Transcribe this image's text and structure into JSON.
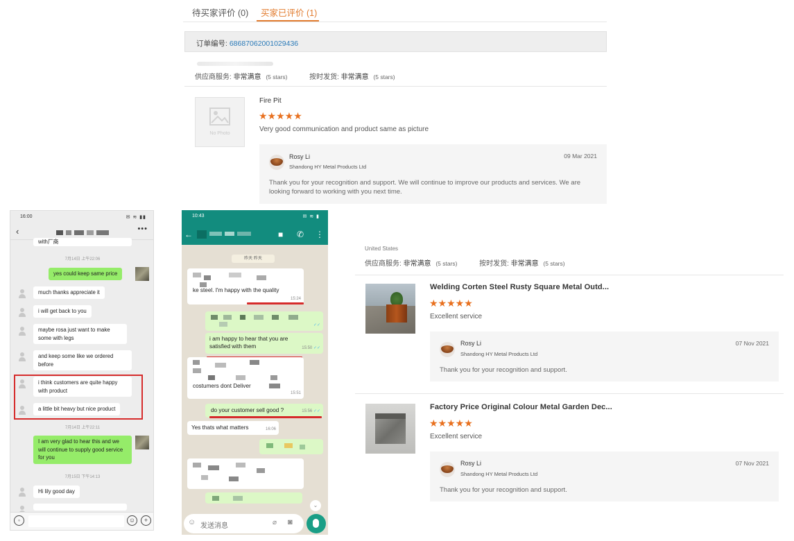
{
  "top_panel": {
    "tabs": [
      {
        "label": "待买家评价 (0)",
        "active": false
      },
      {
        "label": "买家已评价 (1)",
        "active": true
      }
    ],
    "order_label": "订单编号:",
    "order_number": "68687062001029436",
    "ratings": {
      "service_label": "供应商服务:",
      "service_value": "非常满意",
      "service_stars": "(5 stars)",
      "delivery_label": "按时发货:",
      "delivery_value": "非常满意",
      "delivery_stars": "(5 stars)"
    },
    "review": {
      "product": "Fire Pit",
      "no_photo_text": "No Photo",
      "stars": "★★★★★",
      "text": "Very good communication and product same as picture",
      "reply": {
        "name": "Rosy Li",
        "company": "Shandong HY Metal Products Ltd",
        "date": "09 Mar 2021",
        "text": "Thank you for your recognition and support. We will continue to improve our products and services. We are looking forward to working with you next time."
      }
    }
  },
  "chat_left": {
    "status_time": "16:00",
    "status_icons": "✉ ≋ ▮▮",
    "more": "•••",
    "messages": [
      {
        "text": "with厂商",
        "side": "in"
      },
      {
        "timestamp": "7月14日 上午22:06"
      },
      {
        "text": "yes could keep same price",
        "side": "out"
      },
      {
        "text": "much thanks appreciate it",
        "side": "in"
      },
      {
        "text": "i will get back to you",
        "side": "in"
      },
      {
        "text": "maybe rosa just want to make some with legs",
        "side": "in"
      },
      {
        "text": "and keep some like we ordered before",
        "side": "in"
      },
      {
        "text": "i think customers are quite happy with product",
        "side": "in"
      },
      {
        "text": "a little bit heavy but nice product",
        "side": "in"
      },
      {
        "timestamp": "7月14日 上午22:11"
      },
      {
        "text": "I am very glad to hear this and we will continue to supply good service for you",
        "side": "out"
      },
      {
        "timestamp": "7月15日 下午14:13"
      },
      {
        "text": "Hi lily good day",
        "side": "in"
      }
    ]
  },
  "chat_mid": {
    "status_time": "10:43",
    "status_icons": "✉ ≋ ▮",
    "date_chip": "昨天 昨天",
    "messages": [
      {
        "text": "ke steel. I'm happy with the quality",
        "time": "15:24",
        "side": "in"
      },
      {
        "text": "",
        "time": "",
        "side": "out"
      },
      {
        "text": "i am happy to hear that you are satisfied with them",
        "time": "15:50",
        "side": "out"
      },
      {
        "text": "costumers dont Deliver",
        "time": "15:51",
        "side": "in"
      },
      {
        "text": "do your customer sell good ?",
        "time": "15:56",
        "side": "out"
      },
      {
        "text": "Yes thats what matters",
        "time": "16:06",
        "side": "in"
      }
    ],
    "input_placeholder": "发送消息"
  },
  "reviews_right": {
    "country": "United States",
    "ratings": {
      "service_label": "供应商服务:",
      "service_value": "非常满意",
      "service_stars": "(5 stars)",
      "delivery_label": "按时发货:",
      "delivery_value": "非常满意",
      "delivery_stars": "(5 stars)"
    },
    "items": [
      {
        "title": "Welding Corten Steel Rusty Square Metal Outd...",
        "stars": "★★★★★",
        "text": "Excellent service",
        "reply_name": "Rosy Li",
        "reply_company": "Shandong HY Metal Products Ltd",
        "reply_date": "07 Nov 2021",
        "reply_text": "Thank you for your recognition and support."
      },
      {
        "title": "Factory Price Original Colour Metal Garden Dec...",
        "stars": "★★★★★",
        "text": "Excellent service",
        "reply_name": "Rosy Li",
        "reply_company": "Shandong HY Metal Products Ltd",
        "reply_date": "07 Nov 2021",
        "reply_text": "Thank you for your recognition and support."
      }
    ]
  },
  "colors": {
    "accent_orange": "#e27c2f",
    "star_orange": "#e8701f",
    "link_blue": "#2a7ab8",
    "wechat_green": "#95ec69",
    "whatsapp_teal": "#128c7e",
    "highlight_red": "#d62b2b"
  }
}
